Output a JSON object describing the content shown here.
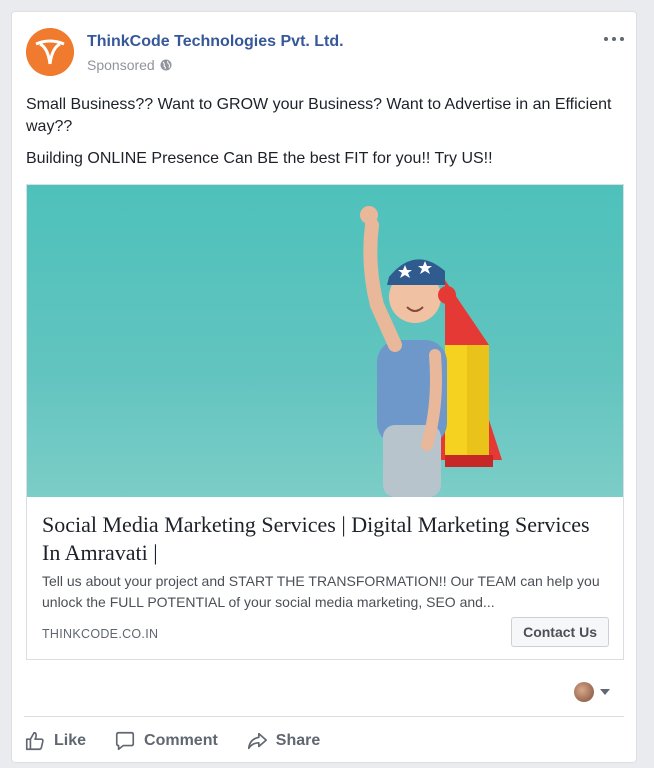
{
  "post": {
    "page_name": "ThinkCode Technologies Pvt. Ltd.",
    "sponsored_label": "Sponsored",
    "text_lines": [
      "Small Business?? Want to GROW your Business? Want to Advertise in an Efficient way??",
      "Building ONLINE Presence Can BE the best FIT for you!! Try US!!"
    ]
  },
  "link": {
    "title": "Social Media Marketing Services | Digital Marketing Services In Amravati |",
    "description": "Tell us about your project and START THE TRANSFORMATION!! Our TEAM can help you unlock the FULL POTENTIAL of your social media marketing, SEO and...",
    "domain": "THINKCODE.CO.IN",
    "cta_label": "Contact Us"
  },
  "actions": {
    "like": "Like",
    "comment": "Comment",
    "share": "Share"
  },
  "colors": {
    "brand": "#f07a2d",
    "link_blue": "#365899",
    "sky": "#4ec1bb"
  }
}
